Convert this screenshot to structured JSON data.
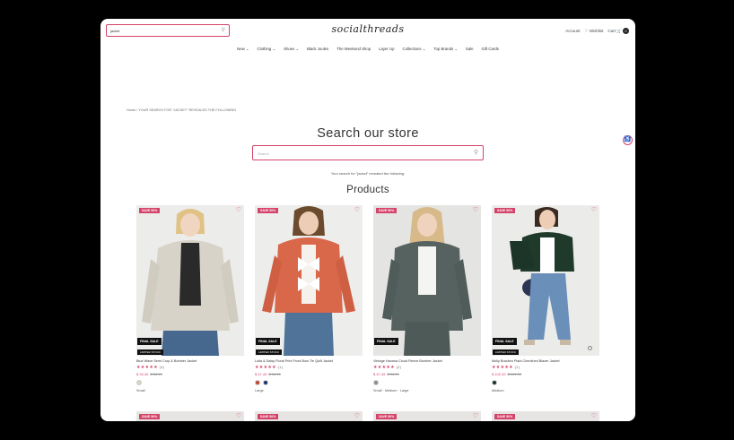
{
  "header": {
    "search_value": "jacket",
    "logo": "socialthreads",
    "account": "Account",
    "wishlist": "Wishlist",
    "cart": "Cart",
    "cart_count": "0"
  },
  "nav": [
    "New",
    "Clothing",
    "Shoes",
    "Black Joules",
    "The Weekend Shop",
    "Layer Up",
    "Collections",
    "Top Brands",
    "Sale",
    "Gift Cards"
  ],
  "breadcrumb": "Home  /  YOUR SEARCH FOR \"JACKET\" REVEALED THE FOLLOWING",
  "page": {
    "heading": "Search our store",
    "search_placeholder": "Search",
    "result_note": "Your search for \"jacket\" revealed the following:",
    "products_title": "Products"
  },
  "products": [
    {
      "name": "Blue Wave Semi Crop & Bomber Jacket",
      "rating": "(4)",
      "price": "$ 33.49",
      "old_price": "$ 64.99",
      "sizes": "Small",
      "swatches": [
        "#d8d3c8"
      ],
      "sale": "SAVE 50%",
      "final": "FINAL SALE",
      "limited": "LIMITED STOCK"
    },
    {
      "name": "Lolla & Daisy Floral Print Front Bow Tie Quilt Jacket",
      "rating": "(1)",
      "price": "$ 47.49",
      "old_price": "$ 94.99",
      "sizes": "Large",
      "swatches": [
        "#c2462e",
        "#23346b"
      ],
      "sale": "SAVE 50%",
      "final": "FINAL SALE",
      "limited": "LIMITED STOCK"
    },
    {
      "name": "Vintage Havana Cloud Fleece Bomber Jacket",
      "rating": "(2)",
      "price": "$ 47.49",
      "old_price": "$ 94.99",
      "sizes": "Small  · Medium  · Large",
      "swatches": [
        "#51605f"
      ],
      "sale": "SAVE 50%",
      "final": "FINAL SALE",
      "limited": ""
    },
    {
      "name": "Molly Bracken Plaid Cherished Blazer Jacket",
      "rating": "(1)",
      "price": "$ 102.49",
      "old_price": "$ 149.99",
      "sizes": "Medium",
      "swatches": [
        "#1d3529"
      ],
      "sale": "SAVE 50%",
      "final": "FINAL SALE",
      "limited": "LIMITED STOCK"
    }
  ],
  "next_row_badges": [
    "SAVE 50%",
    "SAVE 50%",
    "SAVE 50%",
    "SAVE 50%"
  ],
  "colors": {
    "accent": "#d4446a",
    "dark": "#111111"
  },
  "icons": [
    "search-icon",
    "heart-icon",
    "cart-icon",
    "accessibility-icon"
  ]
}
